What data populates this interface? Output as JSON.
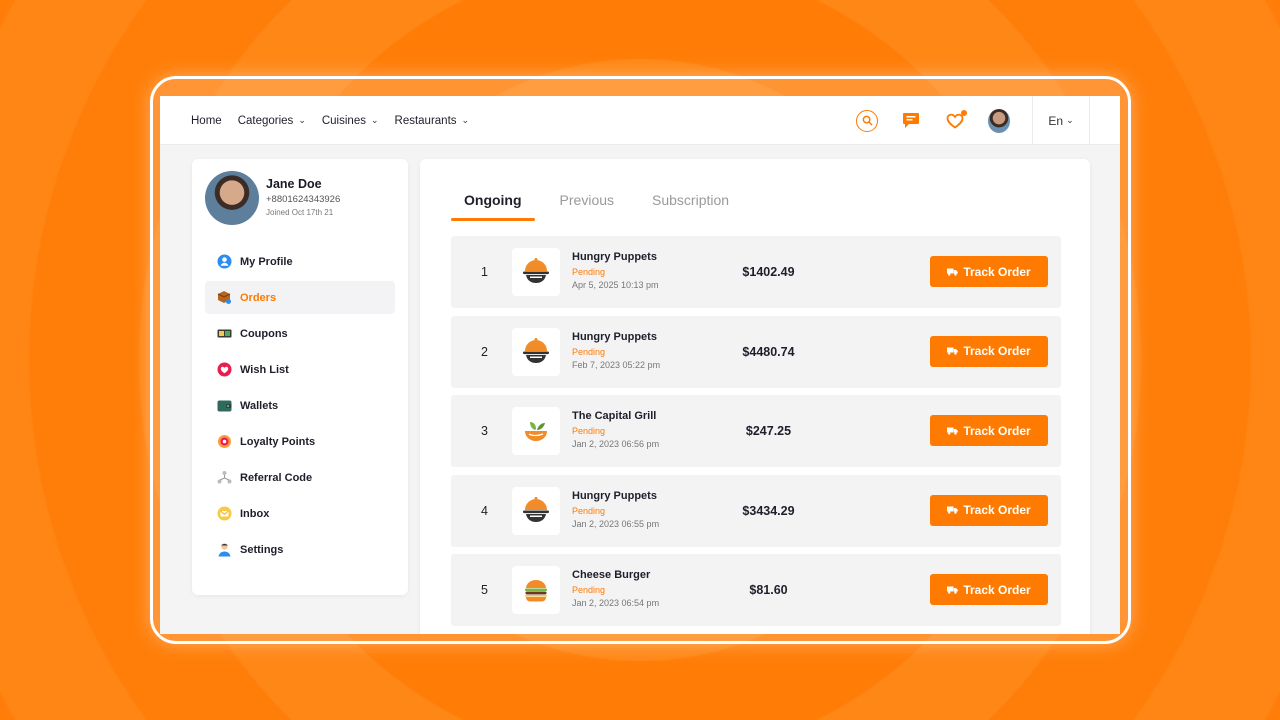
{
  "colors": {
    "accent": "#ff7a00",
    "background": "#ff7f0a"
  },
  "header": {
    "nav": [
      {
        "label": "Home",
        "has_dropdown": false
      },
      {
        "label": "Categories",
        "has_dropdown": true
      },
      {
        "label": "Cuisines",
        "has_dropdown": true
      },
      {
        "label": "Restaurants",
        "has_dropdown": true
      }
    ],
    "icons": [
      "search-icon",
      "chat-icon",
      "wishlist-heart-icon",
      "user-avatar"
    ],
    "language": "En"
  },
  "profile": {
    "name": "Jane Doe",
    "phone": "+8801624343926",
    "joined": "Joined Oct 17th 21"
  },
  "sidebar": {
    "items": [
      {
        "label": "My Profile",
        "icon": "profile-icon"
      },
      {
        "label": "Orders",
        "icon": "orders-box-icon",
        "active": true
      },
      {
        "label": "Coupons",
        "icon": "coupon-icon"
      },
      {
        "label": "Wish List",
        "icon": "heart-icon"
      },
      {
        "label": "Wallets",
        "icon": "wallet-icon"
      },
      {
        "label": "Loyalty Points",
        "icon": "loyalty-icon"
      },
      {
        "label": "Referral Code",
        "icon": "referral-icon"
      },
      {
        "label": "Inbox",
        "icon": "inbox-icon"
      },
      {
        "label": "Settings",
        "icon": "settings-user-icon"
      }
    ]
  },
  "tabs": [
    {
      "label": "Ongoing",
      "active": true
    },
    {
      "label": "Previous"
    },
    {
      "label": "Subscription"
    }
  ],
  "orders": [
    {
      "num": "1",
      "name": "Hungry Puppets",
      "status": "Pending",
      "date": "Apr 5, 2025 10:13 pm",
      "price": "$1402.49",
      "logo": "bowl-logo-icon"
    },
    {
      "num": "2",
      "name": "Hungry Puppets",
      "status": "Pending",
      "date": "Feb 7, 2023 05:22 pm",
      "price": "$4480.74",
      "logo": "bowl-logo-icon"
    },
    {
      "num": "3",
      "name": "The Capital Grill",
      "status": "Pending",
      "date": "Jan 2, 2023 06:56 pm",
      "price": "$247.25",
      "logo": "salad-logo-icon"
    },
    {
      "num": "4",
      "name": "Hungry Puppets",
      "status": "Pending",
      "date": "Jan 2, 2023 06:55 pm",
      "price": "$3434.29",
      "logo": "bowl-logo-icon"
    },
    {
      "num": "5",
      "name": "Cheese Burger",
      "status": "Pending",
      "date": "Jan 2, 2023 06:54 pm",
      "price": "$81.60",
      "logo": "burger-logo-icon"
    }
  ],
  "track_label": "Track Order"
}
